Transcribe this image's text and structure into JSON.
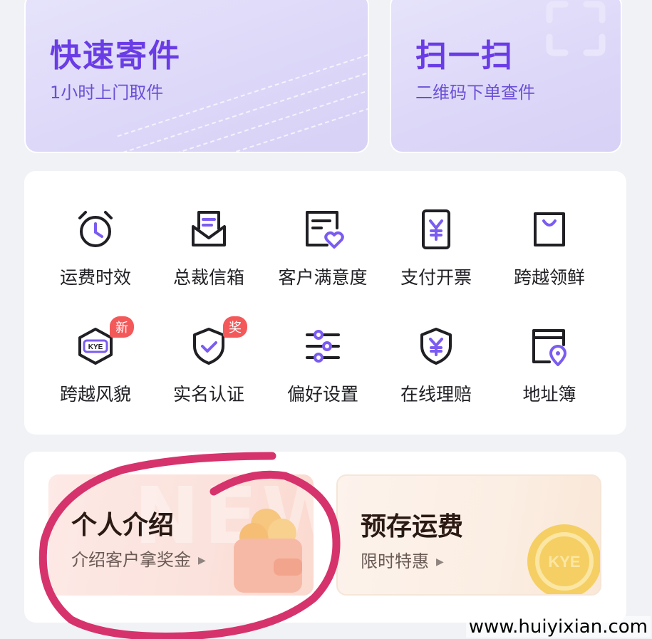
{
  "top_cards": [
    {
      "title": "快速寄件",
      "subtitle": "1小时上门取件"
    },
    {
      "title": "扫一扫",
      "subtitle": "二维码下单查件"
    }
  ],
  "grid": [
    {
      "label": "运费时效",
      "icon": "alarm-clock-icon"
    },
    {
      "label": "总裁信箱",
      "icon": "mail-envelope-icon"
    },
    {
      "label": "客户满意度",
      "icon": "feedback-heart-icon"
    },
    {
      "label": "支付开票",
      "icon": "yuan-invoice-icon"
    },
    {
      "label": "跨越领鲜",
      "icon": "shopping-bag-icon"
    },
    {
      "label": "跨越风貌",
      "icon": "kye-hexagon-icon",
      "badge": "新"
    },
    {
      "label": "实名认证",
      "icon": "shield-check-icon",
      "badge": "奖"
    },
    {
      "label": "偏好设置",
      "icon": "sliders-icon"
    },
    {
      "label": "在线理赔",
      "icon": "shield-yuan-icon"
    },
    {
      "label": "地址簿",
      "icon": "address-location-icon"
    }
  ],
  "promos": [
    {
      "title": "个人介绍",
      "subtitle": "介绍客户拿奖金",
      "arrow": "▶"
    },
    {
      "title": "预存运费",
      "subtitle": "限时特惠",
      "arrow": "▶"
    }
  ],
  "promo_bg_text": "NEW",
  "coin_logo": "KYE",
  "site_watermark": "www.huiyixian.com",
  "colors": {
    "accent_purple": "#6a3ce6",
    "badge_red": "#f4595a",
    "annotation_circle": "#d6336c",
    "icon_purple": "#7b5cf0"
  }
}
